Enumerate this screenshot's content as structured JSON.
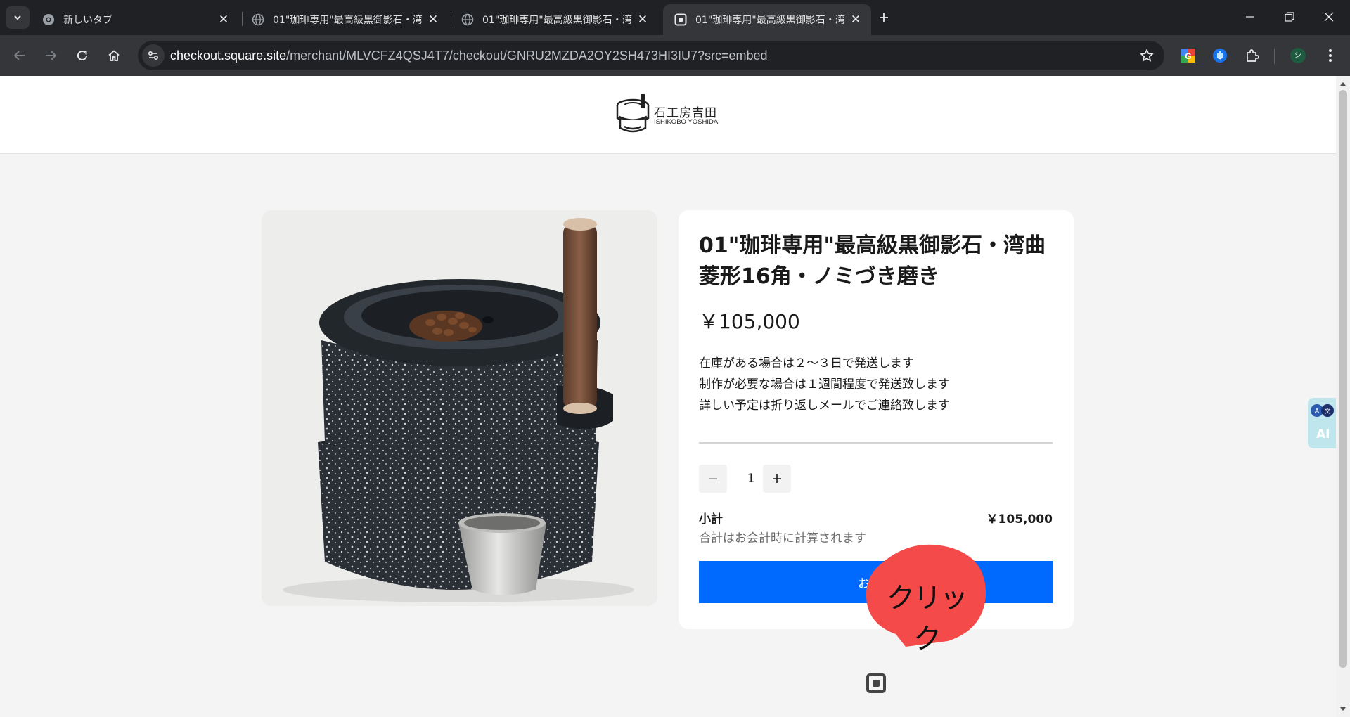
{
  "browser": {
    "tabs": [
      {
        "title": "新しいタブ",
        "active": false,
        "favicon": "chrome-icon"
      },
      {
        "title": "01\"珈琲専用\"最高級黒御影石・湾",
        "active": false,
        "favicon": "globe-icon"
      },
      {
        "title": "01\"珈琲専用\"最高級黒御影石・湾",
        "active": false,
        "favicon": "globe-icon"
      },
      {
        "title": "01\"珈琲専用\"最高級黒御影石・湾",
        "active": true,
        "favicon": "square-icon"
      }
    ],
    "url_host": "checkout.square.site",
    "url_path": "/merchant/MLVCFZ4QSJ4T7/checkout/GNRU2MZDA2OY2SH473HI3IU7?src=embed",
    "profile_initial": "シ"
  },
  "header": {
    "logo_jp": "石工房吉田",
    "logo_en": "ISHIKOBO YOSHIDA"
  },
  "product": {
    "title": "01\"珈琲専用\"最高級黒御影石・湾曲菱形16角・ノミづき磨き",
    "price": "￥105,000",
    "description": [
      "在庫がある場合は２～３日で発送します",
      "制作が必要な場合は１週間程度で発送致します",
      "詳しい予定は折り返しメールでご連絡致します"
    ],
    "quantity": "1"
  },
  "summary": {
    "label": "小計",
    "note": "合計はお会計時に計算されます",
    "value": "￥105,000"
  },
  "checkout_label": "お会計",
  "annotation": {
    "text": "クリック",
    "color": "#f44a4a"
  },
  "ai_widget": {
    "label": "AI"
  },
  "colors": {
    "accent": "#006aff",
    "chrome_dark": "#202124",
    "chrome_toolbar": "#35363a"
  }
}
